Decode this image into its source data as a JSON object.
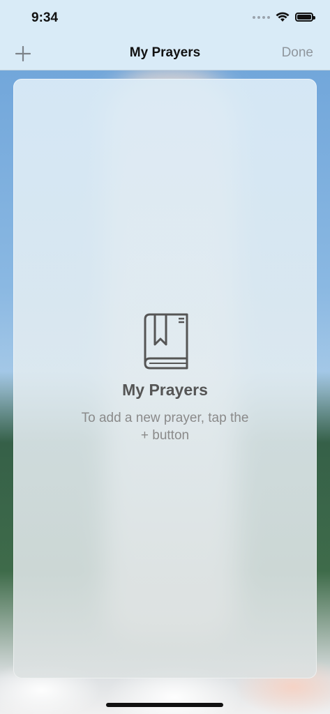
{
  "status_bar": {
    "time": "9:34"
  },
  "nav": {
    "title": "My Prayers",
    "add_icon": "plus-icon",
    "done_label": "Done"
  },
  "empty_state": {
    "icon": "book-icon",
    "title": "My Prayers",
    "message": "To add a new prayer, tap the + button"
  },
  "colors": {
    "nav_background": "#d9ebf7",
    "title_text": "#555555",
    "secondary_text": "#8a8a8a",
    "done_text": "#8f969d"
  }
}
